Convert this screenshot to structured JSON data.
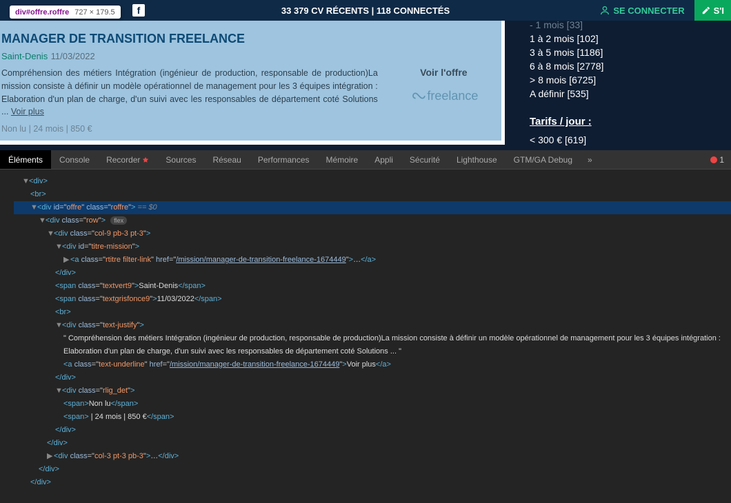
{
  "tooltip": {
    "selector": "div#offre.roffre",
    "dims": "727 × 179.5"
  },
  "topbar": {
    "stats": "33 379 CV RÉCENTS  |  118 CONNECTÉS",
    "connect": "SE CONNECTER",
    "extra": "S'I"
  },
  "offer": {
    "title": "MANAGER DE TRANSITION FREELANCE",
    "location": "Saint-Denis",
    "date": "11/03/2022",
    "desc": "Compréhension des métiers Intégration (ingénieur de production, responsable de production)La mission consiste à définir un modèle opérationnel de management pour les 3 équipes intégration : Elaboration d'un plan de charge, d'un suivi avec les responsables de département coté Solutions ... ",
    "voir": "Voir plus",
    "status": "Non lu",
    "meta_rest": "  |  24 mois  |  850 €",
    "see_label": "Voir l'offre",
    "logo_text": "reelance"
  },
  "sidebar": {
    "durations": [
      "- 1 mois [33]",
      "1 à 2 mois [102]",
      "3 à 5 mois [1186]",
      "6 à 8 mois [2778]",
      "> 8 mois [6725]",
      "A définir [535]"
    ],
    "tarifs_title": "Tarifs / jour :",
    "tarifs_first": "< 300 € [619]"
  },
  "devtabs": [
    "Éléments",
    "Console",
    "Recorder",
    "Sources",
    "Réseau",
    "Performances",
    "Mémoire",
    "Appli",
    "Sécurité",
    "Lighthouse",
    "GTM/GA Debug"
  ],
  "errcount": "1",
  "dom": {
    "eq": " == $0",
    "href1": "/mission/manager-de-transition-freelance-1674449",
    "txt_loc": "Saint-Denis",
    "txt_date": "11/03/2022",
    "txt_desc": "\" Compréhension des métiers Intégration (ingénieur de production, responsable de production)La mission consiste à définir un modèle opérationnel de management pour les 3 équipes intégration : Elaboration d'un plan de charge, d'un suivi avec les responsables de département coté Solutions ... \"",
    "txt_voir": "Voir plus",
    "txt_nonlu": "Non lu",
    "txt_meta": " | 24 mois | 850 €"
  }
}
